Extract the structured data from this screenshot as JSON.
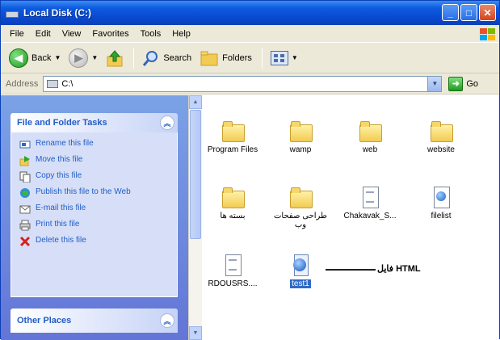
{
  "window": {
    "title": "Local Disk (C:)"
  },
  "menu": [
    "File",
    "Edit",
    "View",
    "Favorites",
    "Tools",
    "Help"
  ],
  "toolbar": {
    "back_label": "Back",
    "search_label": "Search",
    "folders_label": "Folders"
  },
  "address": {
    "label": "Address",
    "value": "C:\\",
    "go_label": "Go"
  },
  "left_panel": {
    "tasks_title": "File and Folder Tasks",
    "tasks": [
      {
        "label": "Rename this file",
        "icon": "rename-icon"
      },
      {
        "label": "Move this file",
        "icon": "move-icon"
      },
      {
        "label": "Copy this file",
        "icon": "copy-icon"
      },
      {
        "label": "Publish this file to the Web",
        "icon": "publish-icon"
      },
      {
        "label": "E-mail this file",
        "icon": "email-icon"
      },
      {
        "label": "Print this file",
        "icon": "print-icon"
      },
      {
        "label": "Delete this file",
        "icon": "delete-icon"
      }
    ],
    "other_title": "Other Places"
  },
  "files": [
    {
      "name": "Program Files",
      "type": "folder"
    },
    {
      "name": "wamp",
      "type": "folder"
    },
    {
      "name": "web",
      "type": "folder"
    },
    {
      "name": "website",
      "type": "folder"
    },
    {
      "name": "بسته ها",
      "type": "folder"
    },
    {
      "name": "طراحی صفحات وب",
      "type": "folder"
    },
    {
      "name": "Chakavak_S...",
      "type": "document"
    },
    {
      "name": "filelist",
      "type": "web-document"
    },
    {
      "name": "RDOUSRS....",
      "type": "document"
    },
    {
      "name": "test1",
      "type": "html",
      "selected": true
    }
  ],
  "annotation": {
    "text": "فایل HTML"
  }
}
